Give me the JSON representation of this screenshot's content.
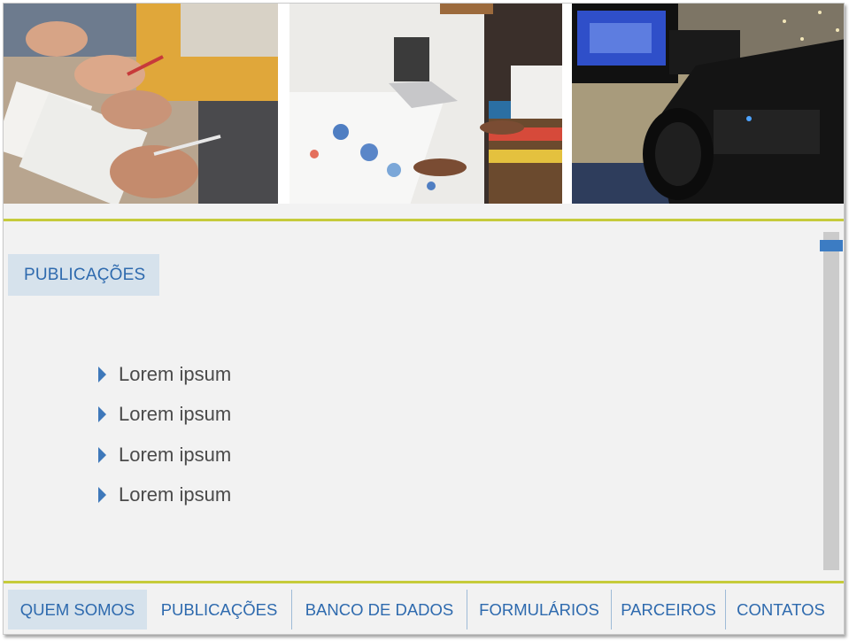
{
  "hero": {
    "images": [
      {
        "icon": "meeting-notes-photo"
      },
      {
        "icon": "laptop-charts-photo"
      },
      {
        "icon": "video-camera-photo"
      }
    ]
  },
  "section": {
    "title": "PUBLICAÇÕES"
  },
  "list": {
    "items": [
      "Lorem ipsum",
      "Lorem ipsum",
      "Lorem ipsum",
      "Lorem ipsum"
    ]
  },
  "nav": {
    "items": [
      "QUEM SOMOS",
      "PUBLICAÇÕES",
      "BANCO DE DADOS",
      "FORMULÁRIOS",
      "PARCEIROS",
      "CONTATOS"
    ],
    "active_index": 0
  },
  "colors": {
    "accent_rule": "#c6cb3b",
    "brand_blue": "#2e6aae",
    "tab_background": "#d6e2ec",
    "scroll_thumb": "#3c7cc3"
  }
}
